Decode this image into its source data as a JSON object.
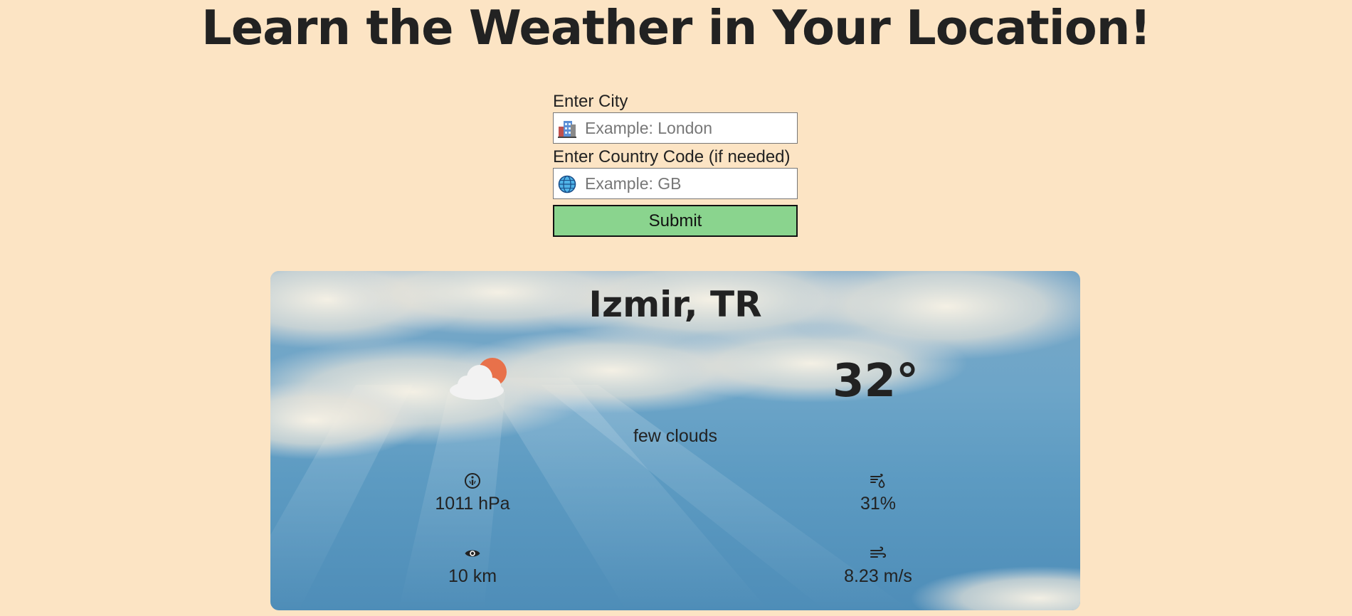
{
  "header": {
    "title": "Learn the Weather in Your Location!"
  },
  "form": {
    "city_label": "Enter City",
    "city_placeholder": "Example: London",
    "city_value": "",
    "country_label": "Enter Country Code (if needed)",
    "country_placeholder": "Example: GB",
    "country_value": "",
    "submit_label": "Submit"
  },
  "weather": {
    "location": "Izmir, TR",
    "temperature": "32°",
    "description": "few clouds",
    "condition_icon": "few-clouds-icon",
    "pressure": {
      "icon": "pressure-gauge-icon",
      "value": "1011 hPa"
    },
    "humidity": {
      "icon": "humidity-icon",
      "value": "31%"
    },
    "visibility": {
      "icon": "eye-icon",
      "value": "10 km"
    },
    "wind": {
      "icon": "wind-icon",
      "value": "8.23 m/s"
    }
  },
  "colors": {
    "page_background": "#fce4c4",
    "submit_background": "#8ad48e",
    "sun": "#e8714a"
  }
}
